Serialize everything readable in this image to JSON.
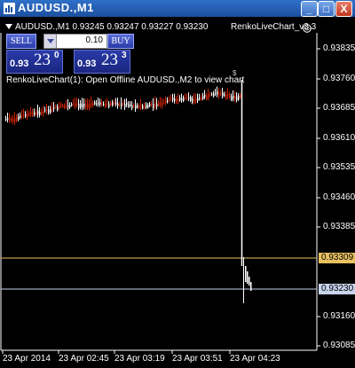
{
  "window": {
    "title": "AUDUSD.,M1",
    "minimize": "_",
    "restore": "□",
    "close": "X"
  },
  "chart_header": {
    "symbol_info": "AUDUSD.,M1  0.93245 0.93247 0.93227 0.93230",
    "indicator_label": "RenkoLiveChart_v3.3",
    "message": "RenkoLiveChart(1): Open Offline AUDUSD.,M2 to view chart"
  },
  "trade_panel": {
    "sell_label": "SELL",
    "buy_label": "BUY",
    "lot_value": "0.10",
    "sell_price_small": "0.93",
    "sell_price_big": "23",
    "sell_price_sup": "0",
    "buy_price_small": "0.93",
    "buy_price_big": "23",
    "buy_price_sup": "3"
  },
  "marker_label": "$",
  "price_axis": {
    "ticks": [
      "0.93835",
      "0.93760",
      "0.93685",
      "0.93610",
      "0.93535",
      "0.93460",
      "0.93385",
      "0.93160",
      "0.93085"
    ],
    "highlight_yellow": "0.93309",
    "highlight_gray": "0.93230"
  },
  "time_axis": {
    "ticks": [
      "23 Apr 2014",
      "23 Apr 02:45",
      "23 Apr 03:19",
      "23 Apr 03:51",
      "23 Apr 04:23"
    ]
  },
  "colors": {
    "bull": "#ffffff",
    "bear": "#cc2200",
    "yellow_line": "#e8c060",
    "gray_line": "#c8d4ec"
  }
}
